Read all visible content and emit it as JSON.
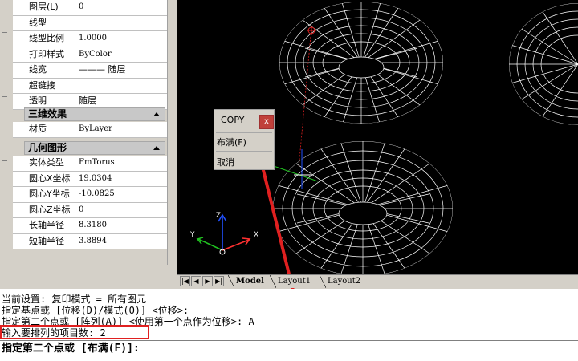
{
  "properties_top": [
    {
      "key": "图层(L)",
      "value": "0"
    },
    {
      "key": "线型",
      "value": ""
    },
    {
      "key": "线型比例",
      "value": "1.0000"
    },
    {
      "key": "打印样式",
      "value": "ByColor"
    },
    {
      "key": "线宽",
      "value": "——— 随层"
    },
    {
      "key": "超链接",
      "value": ""
    },
    {
      "key": "透明",
      "value": "随层"
    }
  ],
  "cat_3d": {
    "title": "三维效果"
  },
  "properties_3d": [
    {
      "key": "材质",
      "value": "ByLayer"
    }
  ],
  "cat_geometry": {
    "title": "几何图形"
  },
  "properties_geometry": [
    {
      "key": "实体类型",
      "value": "FmTorus"
    },
    {
      "key": "圆心X坐标",
      "value": "19.0304"
    },
    {
      "key": "圆心Y坐标",
      "value": "-10.0825"
    },
    {
      "key": "圆心Z坐标",
      "value": "0"
    },
    {
      "key": "长轴半径",
      "value": "8.3180"
    },
    {
      "key": "短轴半径",
      "value": "3.8894"
    }
  ],
  "tabs": {
    "nav": [
      "|◀",
      "◀",
      "▶",
      "▶|"
    ],
    "items": [
      "Model",
      "Layout1",
      "Layout2"
    ]
  },
  "popup": {
    "title": "COPY",
    "close": "x",
    "items": [
      "布满(F)",
      "取消"
    ]
  },
  "ucs": {
    "x": "X",
    "y": "Y",
    "z": "Z"
  },
  "command": {
    "lines": [
      "当前设置: 复印模式 = 所有图元",
      "指定基点或 [位移(D)/模式(O)] <位移>:",
      "指定第二个点或 [阵列(A)] <使用第一个点作为位移>: A",
      "输入要排列的项目数: 2"
    ],
    "prompt": "指定第二个点或 [布满(F)]:"
  },
  "colors": {
    "viewport_bg": "#000000",
    "wire": "#ffffff",
    "annotation": "#e02020",
    "ucs_x": "#ff3030",
    "ucs_y": "#20c020",
    "ucs_z": "#2050ff"
  }
}
